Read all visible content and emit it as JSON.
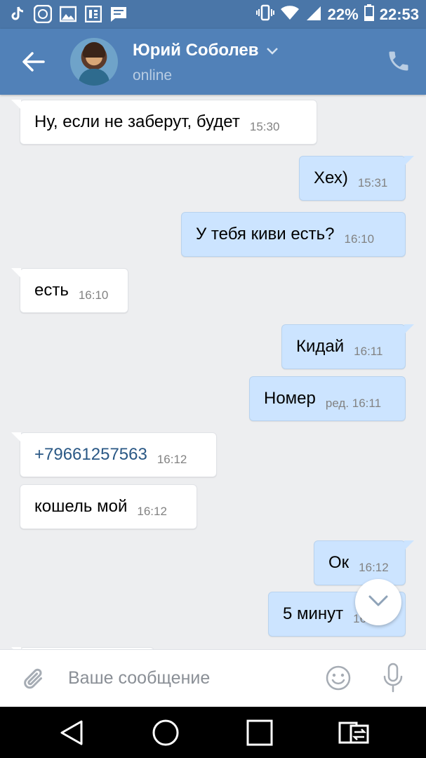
{
  "status_bar": {
    "battery": "22%",
    "time": "22:53",
    "left_icons": [
      "tiktok-icon",
      "mi-icon",
      "gallery-icon",
      "sim-icon",
      "chat-notification-icon"
    ],
    "right_icons": [
      "vibrate-icon",
      "wifi-icon",
      "signal-icon",
      "battery-icon"
    ]
  },
  "header": {
    "name": "Юрий Соболев",
    "status": "online"
  },
  "messages": [
    {
      "dir": "in",
      "text": "Ну, если не заберут, будет",
      "time": "15:30"
    },
    {
      "dir": "out",
      "text": "Хех)",
      "time": "15:31"
    },
    {
      "dir": "out",
      "text": "У тебя киви есть?",
      "time": "16:10"
    },
    {
      "dir": "in",
      "text": "есть",
      "time": "16:10"
    },
    {
      "dir": "out",
      "text": "Кидай",
      "time": "16:11"
    },
    {
      "dir": "out",
      "text": "Номер",
      "time": "ред. 16:11"
    },
    {
      "dir": "in",
      "text": "+79661257563",
      "time": "16:12"
    },
    {
      "dir": "in",
      "text": "кошель мой",
      "time": "16:12"
    },
    {
      "dir": "out",
      "text": "Ок",
      "time": "16:12"
    },
    {
      "dir": "out",
      "text": "5 минут",
      "time": "16:12"
    }
  ],
  "composer": {
    "placeholder": "Ваше сообщение"
  },
  "colors": {
    "header": "#5181b8",
    "status_bar": "#4a76a8",
    "outgoing_bubble": "#cce4ff",
    "incoming_bubble": "#ffffff",
    "chat_background": "#edeef0",
    "link": "#2a5885"
  }
}
